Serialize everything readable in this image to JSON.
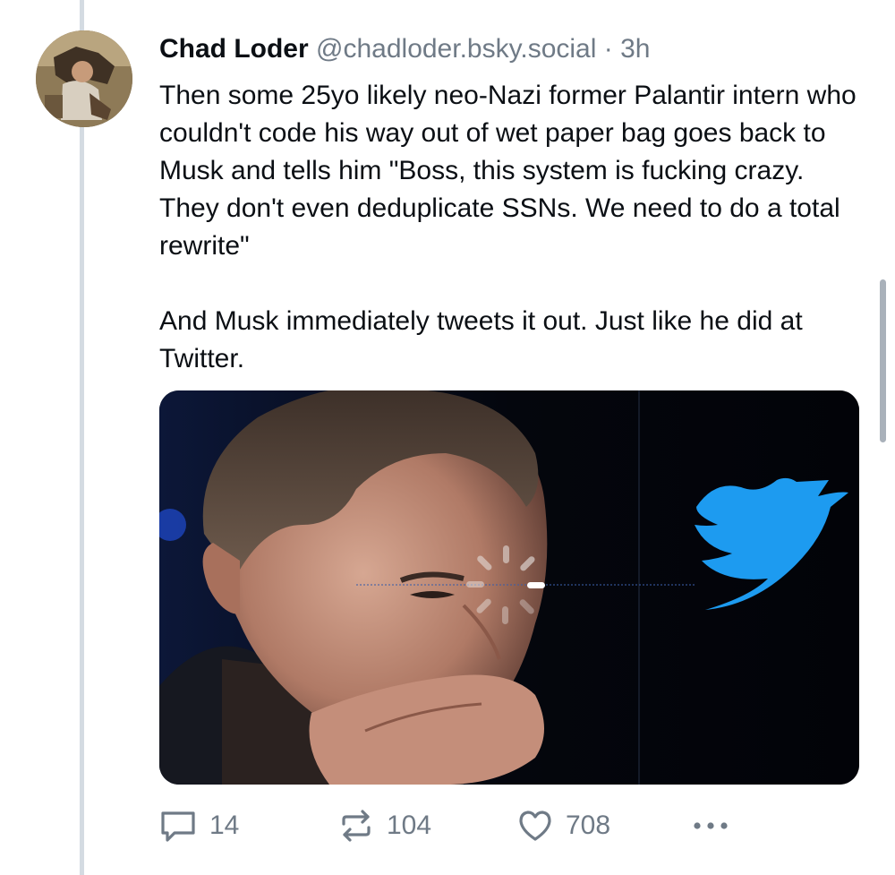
{
  "post": {
    "author_name": "Chad Loder",
    "author_handle": "@chadloder.bsky.social",
    "separator": "·",
    "time": "3h",
    "paragraphs": [
      "Then some 25yo likely neo-Nazi former Palantir intern who couldn't code his way out of wet paper bag goes back to Musk and tells him \"Boss, this system is fucking crazy. They don't even deduplicate SSNs. We need to do a total rewrite\"",
      "And Musk immediately tweets it out. Just like he did at Twitter."
    ]
  },
  "actions": {
    "reply_count": "14",
    "repost_count": "104",
    "like_count": "708"
  },
  "icons": {
    "reply": "speech-bubble-icon",
    "repost": "repost-arrows-icon",
    "like": "heart-icon",
    "more": "more-dots-icon",
    "loading": "loading-spinner-icon",
    "twitter": "twitter-bird-logo"
  },
  "colors": {
    "text": "#0b0f14",
    "muted": "#6f7a86",
    "thread_line": "#d4dbe2",
    "twitter_blue": "#1d9bf0"
  }
}
